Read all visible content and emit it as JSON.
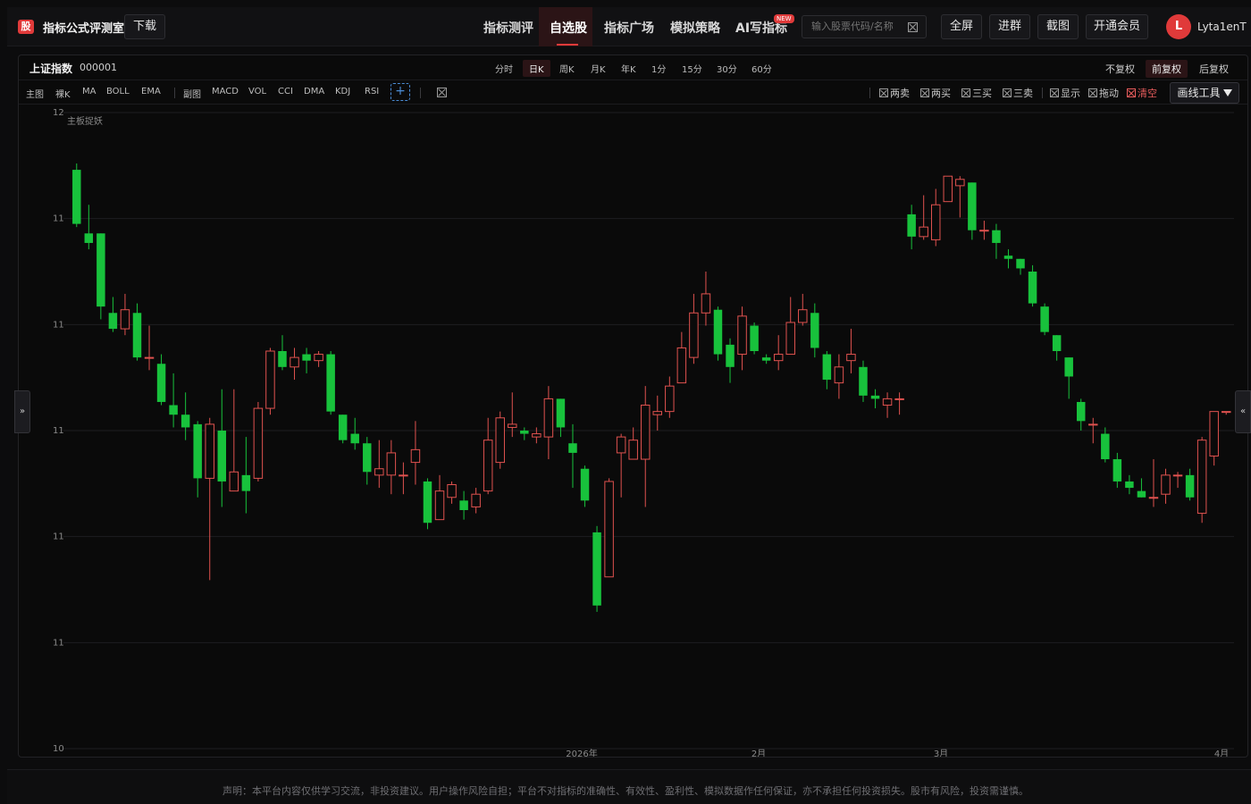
{
  "header": {
    "logo_text": "股",
    "app_title": "指标公式评测室",
    "download_label": "下载",
    "nav": [
      {
        "label": "指标测评",
        "active": false
      },
      {
        "label": "自选股",
        "active": true
      },
      {
        "label": "指标广场",
        "active": false
      },
      {
        "label": "模拟策略",
        "active": false
      },
      {
        "label": "AI写指标",
        "active": false
      }
    ],
    "new_badge": "NEW",
    "search_placeholder": "输入股票代码/名称",
    "fullscreen_label": "全屏",
    "join_group_label": "进群",
    "screenshot_label": "截图",
    "vip_label": "开通会员",
    "avatar_letter": "L",
    "username": "Lyta1enT"
  },
  "stock": {
    "name": "上证指数",
    "code": "000001"
  },
  "periods": [
    {
      "label": "分时",
      "active": false
    },
    {
      "label": "日K",
      "active": true
    },
    {
      "label": "周K",
      "active": false
    },
    {
      "label": "月K",
      "active": false
    },
    {
      "label": "年K",
      "active": false
    },
    {
      "label": "1分",
      "active": false
    },
    {
      "label": "15分",
      "active": false
    },
    {
      "label": "30分",
      "active": false
    },
    {
      "label": "60分",
      "active": false
    }
  ],
  "adjust_modes": [
    {
      "label": "不复权",
      "active": false
    },
    {
      "label": "前复权",
      "active": true
    },
    {
      "label": "后复权",
      "active": false
    }
  ],
  "main_indicators": [
    "主图",
    "裸K",
    "MA",
    "BOLL",
    "EMA"
  ],
  "sub_indicators": [
    "副图",
    "MACD",
    "VOL",
    "CCI",
    "DMA",
    "KDJ",
    "RSI"
  ],
  "plus_label": "+",
  "right_tools": [
    "两卖",
    "两买",
    "三买",
    "三卖",
    "显示",
    "拖动",
    "清空"
  ],
  "draw_tool_label": "画线工具",
  "side_left": "»",
  "side_right": "«",
  "footer": {
    "disclaimer": "声明：本平台内容仅供学习交流，非投资建议。用户操作风险自担；平台不对指标的准确性、有效性、盈利性、模拟数据作任何保证，亦不承担任何投资损失。股市有风险，投资需谨慎。"
  },
  "colors": {
    "up": "#e0524f",
    "down": "#18c23c",
    "accent": "#e03a3a",
    "grid": "#1e1e22"
  },
  "chart_data": {
    "type": "candlestick",
    "overlay_label": "主板捉妖",
    "y_ticks": [
      "12",
      "11",
      "11",
      "11",
      "11",
      "11",
      "10"
    ],
    "x_ticks": [
      "2026年",
      "2月",
      "3月",
      "4月"
    ],
    "ylim": [
      10.0,
      12.0
    ],
    "candles": [
      [
        11.82,
        11.65,
        11.84,
        11.64
      ],
      [
        11.62,
        11.59,
        11.71,
        11.57
      ],
      [
        11.62,
        11.39,
        11.62,
        11.35
      ],
      [
        11.37,
        11.32,
        11.42,
        11.31
      ],
      [
        11.32,
        11.38,
        11.43,
        11.3
      ],
      [
        11.37,
        11.23,
        11.4,
        11.22
      ],
      [
        11.23,
        11.23,
        11.33,
        11.19
      ],
      [
        11.21,
        11.09,
        11.24,
        11.08
      ],
      [
        11.08,
        11.05,
        11.18,
        11.01
      ],
      [
        11.05,
        11.01,
        11.12,
        10.97
      ],
      [
        11.02,
        10.85,
        11.03,
        10.79
      ],
      [
        10.85,
        11.02,
        11.04,
        10.53
      ],
      [
        11.0,
        10.84,
        11.13,
        10.76
      ],
      [
        10.81,
        10.87,
        11.13,
        10.84
      ],
      [
        10.86,
        10.81,
        10.98,
        10.74
      ],
      [
        10.85,
        11.07,
        11.09,
        10.84
      ],
      [
        11.07,
        11.25,
        11.26,
        11.05
      ],
      [
        11.25,
        11.2,
        11.3,
        11.19
      ],
      [
        11.2,
        11.23,
        11.26,
        11.16
      ],
      [
        11.24,
        11.22,
        11.26,
        11.18
      ],
      [
        11.22,
        11.24,
        11.25,
        11.2
      ],
      [
        11.24,
        11.06,
        11.25,
        11.05
      ],
      [
        11.05,
        10.97,
        11.0,
        10.96
      ],
      [
        10.99,
        10.96,
        11.04,
        10.94
      ],
      [
        10.96,
        10.87,
        10.98,
        10.83
      ],
      [
        10.86,
        10.88,
        10.97,
        10.82
      ],
      [
        10.86,
        10.93,
        10.97,
        10.8
      ],
      [
        10.86,
        10.86,
        10.9,
        10.8
      ],
      [
        10.9,
        10.94,
        11.03,
        10.83
      ],
      [
        10.84,
        10.71,
        10.85,
        10.69
      ],
      [
        10.72,
        10.81,
        10.86,
        10.81
      ],
      [
        10.79,
        10.83,
        10.84,
        10.77
      ],
      [
        10.78,
        10.75,
        10.81,
        10.72
      ],
      [
        10.76,
        10.8,
        10.82,
        10.74
      ],
      [
        10.81,
        10.97,
        11.04,
        10.8
      ],
      [
        10.9,
        11.04,
        11.06,
        10.88
      ],
      [
        11.01,
        11.02,
        11.12,
        10.98
      ],
      [
        11.0,
        10.99,
        11.01,
        10.97
      ],
      [
        10.98,
        10.99,
        11.01,
        10.96
      ],
      [
        10.98,
        11.1,
        11.14,
        10.91
      ],
      [
        11.1,
        11.01,
        11.1,
        10.98
      ],
      [
        10.96,
        10.93,
        11.02,
        10.82
      ],
      [
        10.88,
        10.78,
        10.89,
        10.76
      ],
      [
        10.68,
        10.45,
        10.7,
        10.43
      ],
      [
        10.54,
        10.84,
        10.85,
        10.54
      ],
      [
        10.93,
        10.98,
        10.99,
        10.79
      ],
      [
        10.91,
        10.97,
        11.01,
        10.91
      ],
      [
        10.91,
        11.08,
        11.14,
        10.76
      ],
      [
        11.05,
        11.06,
        11.11,
        11.0
      ],
      [
        11.06,
        11.14,
        11.17,
        11.04
      ],
      [
        11.15,
        11.26,
        11.31,
        11.22
      ],
      [
        11.23,
        11.37,
        11.43,
        11.21
      ],
      [
        11.37,
        11.43,
        11.5,
        11.33
      ],
      [
        11.38,
        11.24,
        11.39,
        11.22
      ],
      [
        11.27,
        11.2,
        11.29,
        11.15
      ],
      [
        11.24,
        11.36,
        11.39,
        11.19
      ],
      [
        11.33,
        11.25,
        11.34,
        11.24
      ],
      [
        11.23,
        11.22,
        11.24,
        11.21
      ],
      [
        11.22,
        11.24,
        11.3,
        11.19
      ],
      [
        11.24,
        11.34,
        11.42,
        11.24
      ],
      [
        11.34,
        11.38,
        11.43,
        11.33
      ],
      [
        11.37,
        11.26,
        11.4,
        11.23
      ],
      [
        11.24,
        11.16,
        11.25,
        11.13
      ],
      [
        11.15,
        11.2,
        11.24,
        11.1
      ],
      [
        11.22,
        11.24,
        11.32,
        11.18
      ],
      [
        11.2,
        11.11,
        11.22,
        11.09
      ],
      [
        11.11,
        11.1,
        11.13,
        11.07
      ],
      [
        11.08,
        11.1,
        11.12,
        11.04
      ],
      [
        11.1,
        11.1,
        11.12,
        11.05
      ],
      [
        11.68,
        11.61,
        11.71,
        11.57
      ],
      [
        11.61,
        11.64,
        11.74,
        11.6
      ],
      [
        11.6,
        11.71,
        11.76,
        11.58
      ],
      [
        11.72,
        11.8,
        11.78,
        11.74
      ],
      [
        11.77,
        11.79,
        11.8,
        11.67
      ],
      [
        11.78,
        11.63,
        11.78,
        11.6
      ],
      [
        11.63,
        11.63,
        11.66,
        11.6
      ],
      [
        11.63,
        11.59,
        11.65,
        11.54
      ],
      [
        11.55,
        11.54,
        11.57,
        11.51
      ],
      [
        11.54,
        11.51,
        11.52,
        11.49
      ],
      [
        11.5,
        11.4,
        11.52,
        11.39
      ],
      [
        11.39,
        11.31,
        11.4,
        11.3
      ],
      [
        11.3,
        11.25,
        11.28,
        11.22
      ],
      [
        11.23,
        11.17,
        11.19,
        11.1
      ],
      [
        11.09,
        11.03,
        11.1,
        11.0
      ],
      [
        11.02,
        11.02,
        11.04,
        10.96
      ],
      [
        10.99,
        10.91,
        11.01,
        10.9
      ],
      [
        10.91,
        10.84,
        10.93,
        10.82
      ],
      [
        10.84,
        10.82,
        10.86,
        10.8
      ],
      [
        10.81,
        10.79,
        10.85,
        10.79
      ],
      [
        10.79,
        10.79,
        10.91,
        10.76
      ],
      [
        10.8,
        10.86,
        10.88,
        10.77
      ],
      [
        10.86,
        10.86,
        10.87,
        10.82
      ],
      [
        10.86,
        10.79,
        10.88,
        10.78
      ],
      [
        10.74,
        10.97,
        10.98,
        10.71
      ],
      [
        10.92,
        11.06,
        11.04,
        10.89
      ],
      [
        11.06,
        11.06,
        11.06,
        11.05
      ]
    ]
  }
}
